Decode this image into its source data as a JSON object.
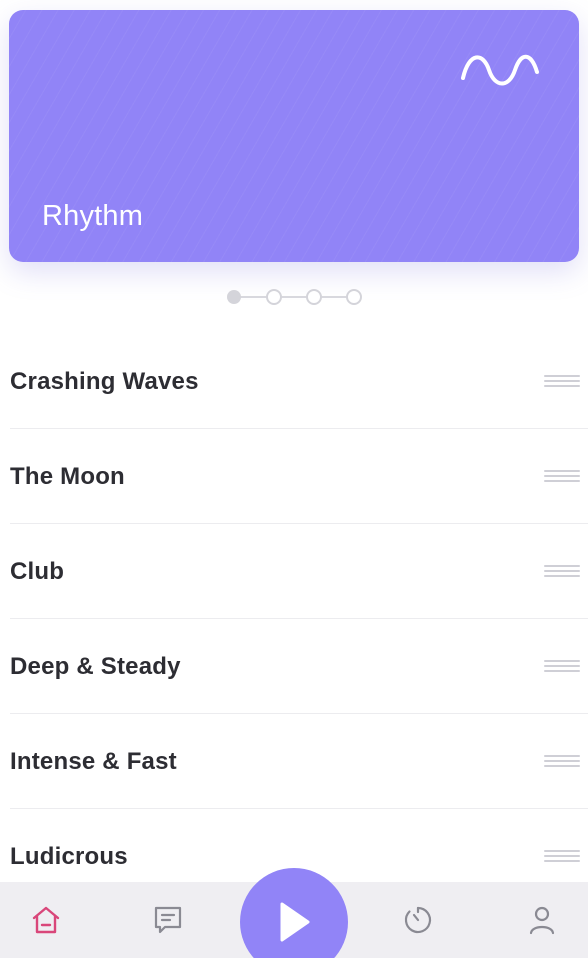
{
  "hero": {
    "title": "Rhythm",
    "icon": "wave-icon",
    "color": "#9184f7"
  },
  "pager": {
    "count": 4,
    "active_index": 0
  },
  "list": {
    "items": [
      {
        "label": "Crashing Waves"
      },
      {
        "label": "The Moon"
      },
      {
        "label": "Club"
      },
      {
        "label": "Deep & Steady"
      },
      {
        "label": "Intense & Fast"
      },
      {
        "label": "Ludicrous"
      }
    ]
  },
  "tabbar": {
    "tabs": [
      {
        "icon": "home-icon",
        "active": true,
        "color": "#d9467a"
      },
      {
        "icon": "message-icon",
        "active": false
      },
      {
        "icon": "play-icon",
        "active": false,
        "color": "#9184f7"
      },
      {
        "icon": "timer-icon",
        "active": false
      },
      {
        "icon": "profile-icon",
        "active": false
      }
    ]
  }
}
